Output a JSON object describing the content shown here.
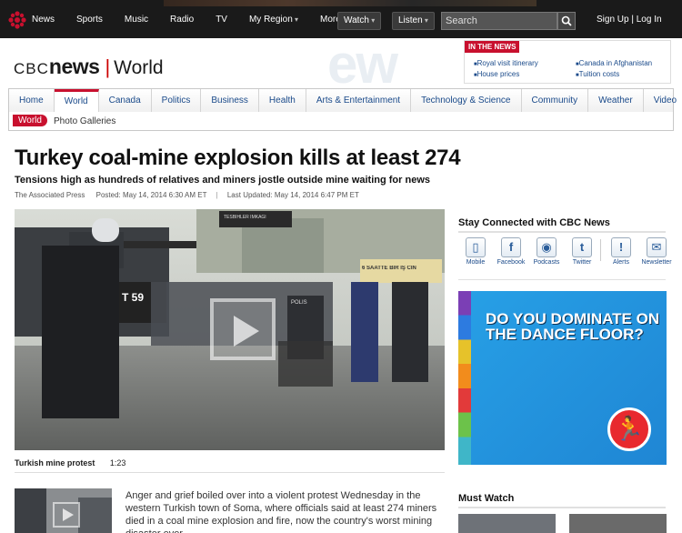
{
  "topnav": {
    "items": [
      "News",
      "Sports",
      "Music",
      "Radio",
      "TV",
      "My Region",
      "More"
    ],
    "watch_label": "Watch",
    "listen_label": "Listen",
    "search_placeholder": "Search",
    "signup_label": "Sign Up | Log In"
  },
  "header": {
    "logo_cbc": "CBC",
    "logo_news": "news",
    "section_title": "World",
    "in_the_news": {
      "tag": "IN THE NEWS",
      "items": [
        "Royal visit itinerary",
        "House prices",
        "Canada in Afghanistan",
        "Tuition costs"
      ]
    }
  },
  "section_nav": {
    "items": [
      "Home",
      "World",
      "Canada",
      "Politics",
      "Business",
      "Health",
      "Arts & Entertainment",
      "Technology & Science",
      "Community",
      "Weather",
      "Video"
    ],
    "active": "World"
  },
  "sub_nav": {
    "pill": "World",
    "link": "Photo Galleries"
  },
  "article": {
    "headline": "Turkey coal-mine explosion kills at least 274",
    "subhead": "Tensions high as hundreds of relatives and miners jostle outside mine waiting for news",
    "source": "The Associated Press",
    "posted": "Posted: May 14, 2014 6:30 AM ET",
    "updated": "Last Updated: May 14, 2014 6:47 PM ET",
    "video_caption": "Turkish mine protest",
    "video_duration": "1:23",
    "photo_texts": [
      "T 59",
      "6 SAATTE BIR İŞ CİN",
      "POLIS",
      "TESBİHLER İMKAĞI"
    ],
    "body": "Anger and grief boiled over into a violent protest Wednesday in the western Turkish town of Soma, where officials said at least 274 miners died in a coal mine explosion and fire, now the country's worst mining disaster ever."
  },
  "sidebar": {
    "stay_connected": "Stay Connected with CBC News",
    "social": [
      {
        "label": "Mobile",
        "icon": "mobile-icon",
        "glyph": "▯"
      },
      {
        "label": "Facebook",
        "icon": "facebook-icon",
        "glyph": "f"
      },
      {
        "label": "Podcasts",
        "icon": "podcast-icon",
        "glyph": "◉"
      },
      {
        "label": "Twitter",
        "icon": "twitter-icon",
        "glyph": "t"
      },
      {
        "label": "Alerts",
        "icon": "alert-icon",
        "glyph": "!"
      },
      {
        "label": "Newsletter",
        "icon": "envelope-icon",
        "glyph": "✉"
      }
    ],
    "ad_text": "DO YOU DOMINATE ON THE DANCE FLOOR?",
    "must_watch": "Must Watch"
  },
  "colors": {
    "brand_red": "#c8102e",
    "link_blue": "#1a4a8a",
    "ad_blue": "#1f8fdc"
  }
}
